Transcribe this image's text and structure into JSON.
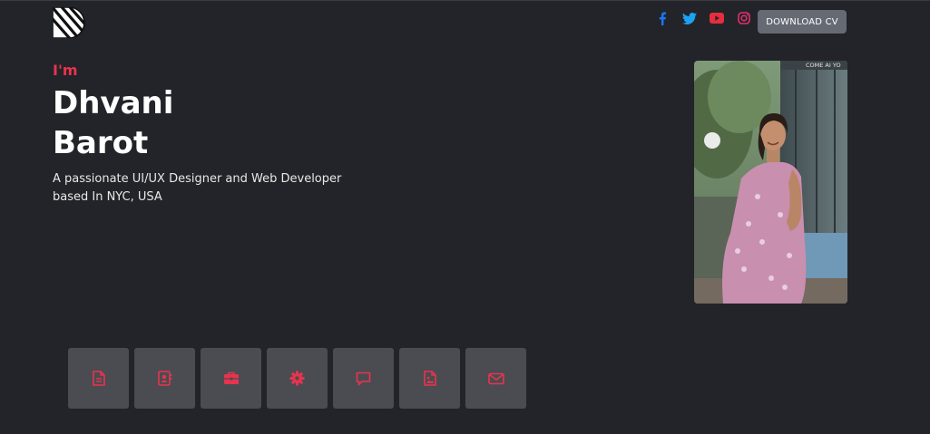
{
  "header": {
    "logo_icon": "striped-logo-icon",
    "socials": [
      {
        "icon": "facebook-icon",
        "color": "#1877f2"
      },
      {
        "icon": "twitter-icon",
        "color": "#1da1f2"
      },
      {
        "icon": "youtube-icon",
        "color": "#e62e3d"
      },
      {
        "icon": "instagram-icon",
        "color": "#e1306c"
      }
    ],
    "download_label": "DOWNLOAD CV"
  },
  "hero": {
    "greeting": "I'm",
    "first_name": "Dhvani",
    "last_name": "Barot",
    "tagline_line1": "A passionate UI/UX Designer and Web Developer",
    "tagline_line2": "based In NYC, USA",
    "photo_sign_text": "COME AI YO"
  },
  "nav_tiles": [
    {
      "icon": "document-icon"
    },
    {
      "icon": "contact-card-icon"
    },
    {
      "icon": "briefcase-icon"
    },
    {
      "icon": "gear-icon"
    },
    {
      "icon": "chat-icon"
    },
    {
      "icon": "image-file-icon"
    },
    {
      "icon": "envelope-icon"
    }
  ],
  "colors": {
    "background": "#222429",
    "accent": "#e9334d",
    "tile": "#4a4c52",
    "button": "#656a73"
  }
}
